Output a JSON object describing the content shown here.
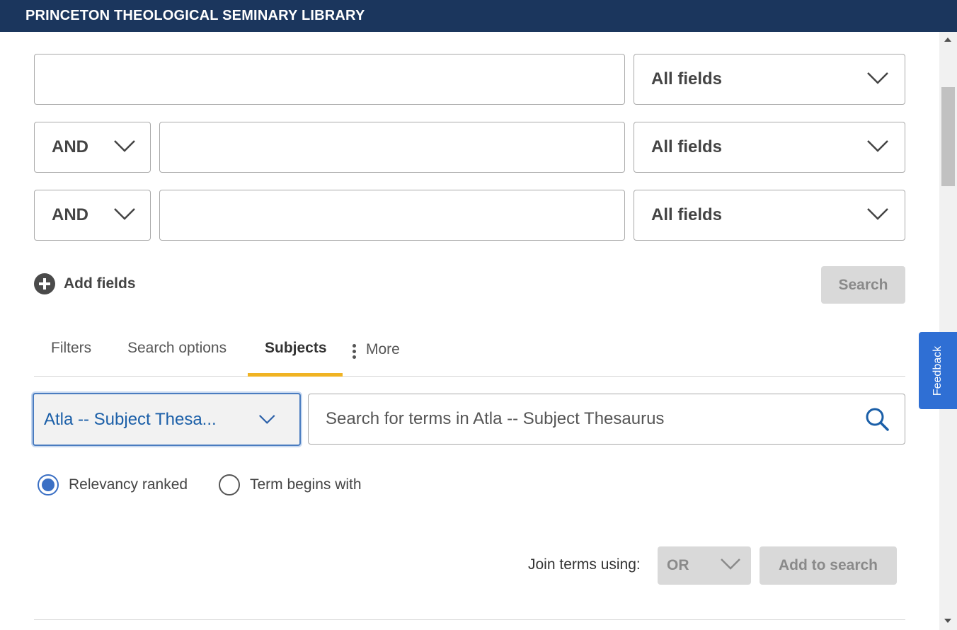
{
  "header": {
    "title": "PRINCETON THEOLOGICAL SEMINARY LIBRARY"
  },
  "rows": [
    {
      "operator": "",
      "field": "All fields",
      "value": ""
    },
    {
      "operator": "AND",
      "field": "All fields",
      "value": ""
    },
    {
      "operator": "AND",
      "field": "All fields",
      "value": ""
    }
  ],
  "actions": {
    "add_fields": "Add fields",
    "search": "Search"
  },
  "tabs": [
    {
      "label": "Filters",
      "active": false
    },
    {
      "label": "Search options",
      "active": false
    },
    {
      "label": "Subjects",
      "active": true
    },
    {
      "label": "More",
      "active": false
    }
  ],
  "subjects": {
    "vocabulary": "Atla -- Subject Thesa...",
    "term_placeholder": "Search for terms in Atla -- Subject Thesaurus",
    "radio_options": [
      {
        "label": "Relevancy ranked",
        "checked": true
      },
      {
        "label": "Term begins with",
        "checked": false
      }
    ],
    "join_label": "Join terms using:",
    "join_value": "OR",
    "add_to_search": "Add to search"
  },
  "feedback": {
    "label": "Feedback"
  },
  "colors": {
    "header_bg": "#1b365d",
    "accent_tab": "#f0b323",
    "link_blue": "#1b5fa8",
    "feedback_bg": "#2f6fd4"
  }
}
